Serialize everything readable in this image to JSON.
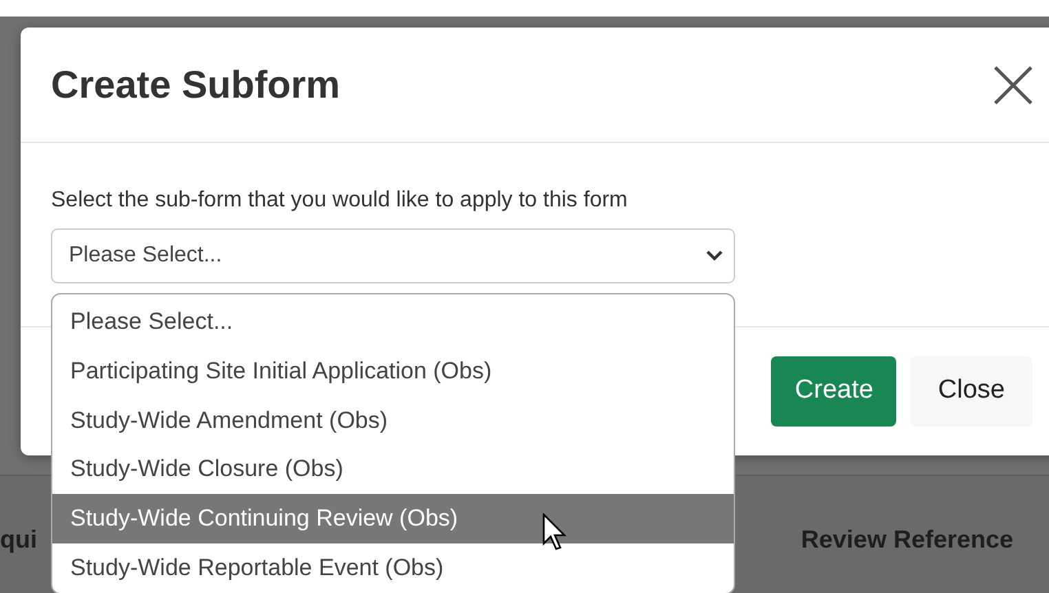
{
  "page_behind": {
    "table_headers": [
      "qui",
      "Review Reference"
    ]
  },
  "modal": {
    "title": "Create Subform",
    "label": "Select the sub-form that you would like to apply to this form",
    "select": {
      "value": "Please Select..."
    },
    "options": [
      {
        "label": "Please Select...",
        "selected": false
      },
      {
        "label": "Participating Site Initial Application (Obs)",
        "selected": false
      },
      {
        "label": "Study-Wide Amendment (Obs)",
        "selected": false
      },
      {
        "label": "Study-Wide Closure (Obs)",
        "selected": false
      },
      {
        "label": "Study-Wide Continuing Review (Obs)",
        "selected": true
      },
      {
        "label": "Study-Wide Reportable Event (Obs)",
        "selected": false
      }
    ],
    "buttons": [
      {
        "label": "Create",
        "kind": "primary"
      },
      {
        "label": "Close",
        "kind": "secondary"
      }
    ]
  }
}
